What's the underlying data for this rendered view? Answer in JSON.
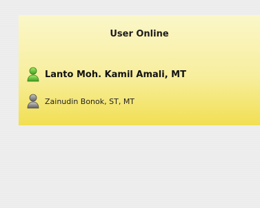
{
  "panel": {
    "title": "User Online",
    "users": [
      {
        "name": "Lanto Moh. Kamil Amali, MT",
        "status": "active",
        "icon": "user-green-icon",
        "color": "#5fbf2e"
      },
      {
        "name": "Zainudin Bonok, ST, MT",
        "status": "idle",
        "icon": "user-gray-icon",
        "color": "#7f7f7f"
      }
    ]
  }
}
